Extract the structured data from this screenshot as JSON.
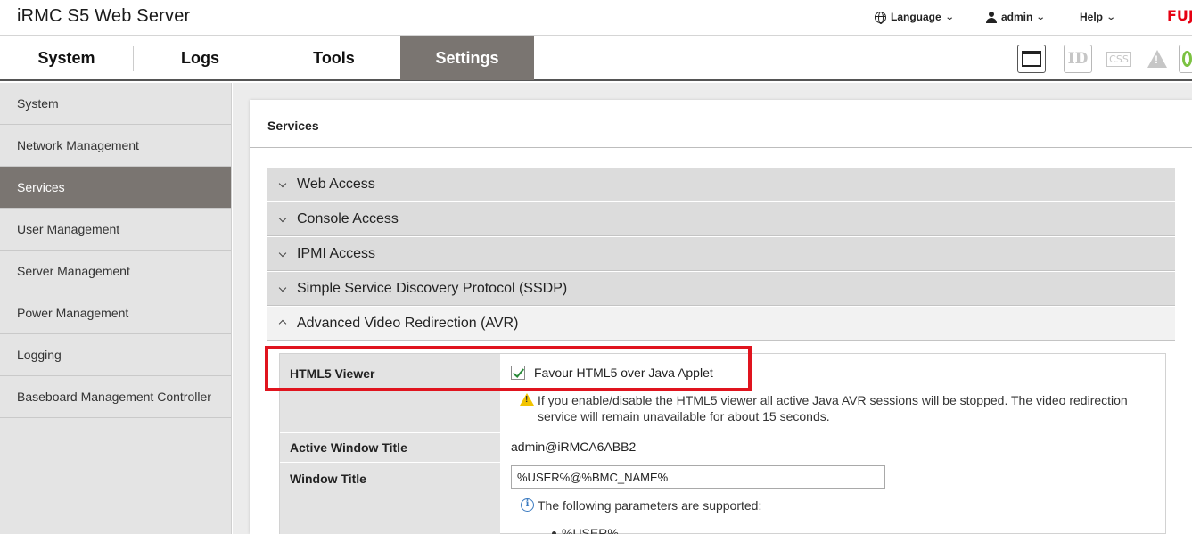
{
  "app": {
    "title": "iRMC S5 Web Server",
    "brand": "FUJITSU"
  },
  "header": {
    "language_label": "Language",
    "user_label": "admin",
    "help_label": "Help"
  },
  "nav": {
    "tabs": [
      {
        "label": "System"
      },
      {
        "label": "Logs"
      },
      {
        "label": "Tools"
      },
      {
        "label": "Settings"
      }
    ],
    "active": "Settings",
    "tools": [
      {
        "icon": "console-window-icon"
      },
      {
        "icon": "id-led-icon",
        "text": "ID"
      },
      {
        "icon": "css-icon",
        "text": "CSS"
      },
      {
        "icon": "warning-icon"
      },
      {
        "icon": "power-icon"
      }
    ]
  },
  "sidebar": {
    "items": [
      {
        "label": "System"
      },
      {
        "label": "Network Management"
      },
      {
        "label": "Services"
      },
      {
        "label": "User Management"
      },
      {
        "label": "Server Management"
      },
      {
        "label": "Power Management"
      },
      {
        "label": "Logging"
      },
      {
        "label": "Baseboard Management Controller"
      }
    ],
    "active": "Services"
  },
  "main": {
    "title": "Services",
    "sections": [
      {
        "label": "Web Access",
        "expanded": false
      },
      {
        "label": "Console Access",
        "expanded": false
      },
      {
        "label": "IPMI Access",
        "expanded": false
      },
      {
        "label": "Simple Service Discovery Protocol (SSDP)",
        "expanded": false
      },
      {
        "label": "Advanced Video Redirection (AVR)",
        "expanded": true
      }
    ],
    "avr": {
      "html5_viewer_label": "HTML5 Viewer",
      "html5_checkbox_label": "Favour HTML5 over Java Applet",
      "html5_checked": true,
      "html5_warning": "If you enable/disable the HTML5 viewer all active Java AVR sessions will be stopped. The video redirection service will remain unavailable for about 15 seconds.",
      "active_window_title_label": "Active Window Title",
      "active_window_title_value": "admin@iRMCA6ABB2",
      "window_title_label": "Window Title",
      "window_title_value": "%USER%@%BMC_NAME%",
      "params_info": "The following parameters are supported:",
      "param_first": "%USER%"
    }
  },
  "colors": {
    "active_tab": "#7a7571",
    "highlight": "#e0141e",
    "check": "#2a8a3a",
    "brand": "#e60012"
  }
}
